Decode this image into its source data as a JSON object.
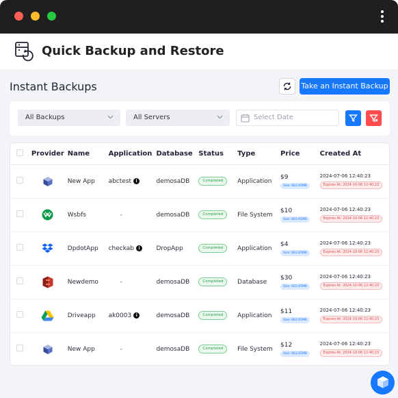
{
  "window": {
    "menu_icon": "kebab-menu-icon"
  },
  "header": {
    "title": "Quick Backup and Restore",
    "icon": "backup-restore-icon"
  },
  "section": {
    "title": "Instant Backups",
    "refresh_icon": "refresh-icon",
    "instant_backup_label": "Take an Instant Backup"
  },
  "filters": {
    "backup_select": "All Backups",
    "server_select": "All Servers",
    "date_placeholder": "Select Date",
    "filter_icon": "filter-icon",
    "clear_filter_icon": "clear-filter-icon"
  },
  "table": {
    "columns": [
      "Provider",
      "Name",
      "Application",
      "Database",
      "Status",
      "Type",
      "Price",
      "Created At"
    ],
    "rows": [
      {
        "provider_icon": "cube-provider-icon",
        "name": "New App",
        "application": "abctest",
        "app_info": true,
        "database": "demosaDB",
        "status": "Completed",
        "type": "Application",
        "price": "$9",
        "size": "Size: 663.65MB",
        "created": "2024-07-06 12:40:23",
        "expires": "Expires At: 2024-10-06 12:40:23"
      },
      {
        "provider_icon": "wasabi-icon",
        "name": "Wsbfs",
        "application": "-",
        "app_info": false,
        "database": "demosaDB",
        "status": "Completed",
        "type": "File System",
        "price": "$10",
        "size": "Size: 663.65MB",
        "created": "2024-07-06 12:40:23",
        "expires": "Expires At: 2024-10-06 12:40:23"
      },
      {
        "provider_icon": "dropbox-icon",
        "name": "DpdotApp",
        "application": "checkab",
        "app_info": true,
        "database": "DropApp",
        "status": "Completed",
        "type": "Application",
        "price": "$4",
        "size": "Size: 663.65MB",
        "created": "2024-07-06 12:40:23",
        "expires": "Expires At: 2024-10-06 12:40:23"
      },
      {
        "provider_icon": "aws-s3-icon",
        "name": "Newdemo",
        "application": "-",
        "app_info": false,
        "database": "demosaDB",
        "status": "Completed",
        "type": "Database",
        "price": "$30",
        "size": "Size: 663.65MB",
        "created": "2024-07-06 12:40:23",
        "expires": "Expires At: 2024-10-06 12:40:23"
      },
      {
        "provider_icon": "google-drive-icon",
        "name": "Driveapp",
        "application": "ak0003",
        "app_info": true,
        "database": "demosaDB",
        "status": "Completed",
        "type": "Application",
        "price": "$11",
        "size": "Size: 663.65MB",
        "created": "2024-07-06 12:40:23",
        "expires": "Expires At: 2024-10-06 12:40:23"
      },
      {
        "provider_icon": "cube-provider-icon",
        "name": "New App",
        "application": "-",
        "app_info": false,
        "database": "demosaDB",
        "status": "Completed",
        "type": "File System",
        "price": "$12",
        "size": "Size: 663.65MB",
        "created": "2024-07-06 12:40:23",
        "expires": "Expires At: 2024-10-06 12:40:23"
      }
    ]
  },
  "fab": {
    "icon": "box-chat-icon"
  },
  "colors": {
    "accent": "#1677ff",
    "danger": "#ff4d4f",
    "success": "#2d9d4a",
    "titlebar": "#1f1f1f",
    "background": "#f3f4f8"
  }
}
